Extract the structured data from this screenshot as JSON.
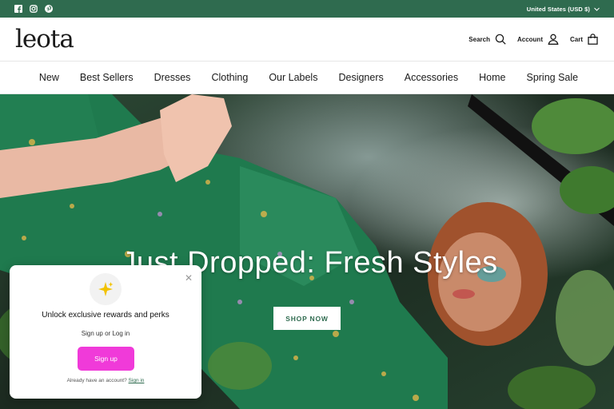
{
  "topbar": {
    "social": [
      "facebook-icon",
      "instagram-icon",
      "pinterest-icon"
    ],
    "currency": "United States (USD $)",
    "background": "#2f6b4f"
  },
  "header": {
    "logo": "leota",
    "search_label": "Search",
    "account_label": "Account",
    "cart_label": "Cart"
  },
  "nav": {
    "items": [
      "New",
      "Best Sellers",
      "Dresses",
      "Clothing",
      "Our Labels",
      "Designers",
      "Accessories",
      "Home",
      "Spring Sale"
    ]
  },
  "hero": {
    "title": "Just Dropped: Fresh Styles",
    "button": "SHOP NOW"
  },
  "popup": {
    "title": "Unlock exclusive rewards and perks",
    "subtitle": "Sign up or Log in",
    "signup_button": "Sign up",
    "footer_text": "Already have an account?",
    "signin_link": "Sign in",
    "accent": "#f03ad9"
  }
}
